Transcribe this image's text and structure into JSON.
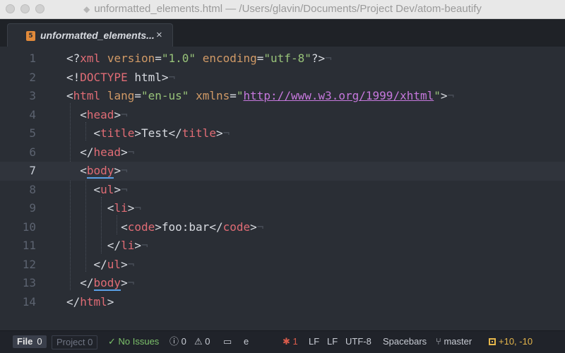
{
  "window": {
    "title": "unformatted_elements.html — /Users/glavin/Documents/Project Dev/atom-beautify"
  },
  "tab": {
    "title": "unformatted_elements...",
    "close": "×"
  },
  "editor": {
    "line_numbers": [
      "1",
      "2",
      "3",
      "4",
      "5",
      "6",
      "7",
      "8",
      "9",
      "10",
      "11",
      "12",
      "13",
      "14"
    ],
    "current_line": 7
  },
  "code": {
    "l1": {
      "open": "<?",
      "xml": "xml",
      "attr1": "version",
      "eq1": "=",
      "val1": "\"1.0\"",
      "attr2": "encoding",
      "eq2": "=",
      "val2": "\"utf-8\"",
      "close": "?>"
    },
    "l2": {
      "open": "<!",
      "doctype": "DOCTYPE",
      "rest": " html",
      "close": ">"
    },
    "l3": {
      "open": "<",
      "tag": "html",
      "attr1": "lang",
      "eq1": "=",
      "val1": "\"en-us\"",
      "attr2": "xmlns",
      "eq2": "=",
      "q1": "\"",
      "url": "http://www.w3.org/1999/xhtml",
      "q2": "\"",
      "close": ">"
    },
    "l4": {
      "open": "<",
      "tag": "head",
      "close": ">"
    },
    "l5": {
      "open": "<",
      "tag": "title",
      "close": ">",
      "text": "Test",
      "open2": "</",
      "tag2": "title",
      "close2": ">"
    },
    "l6": {
      "open": "</",
      "tag": "head",
      "close": ">"
    },
    "l7": {
      "open": "<",
      "tag": "body",
      "close": ">"
    },
    "l8": {
      "open": "<",
      "tag": "ul",
      "close": ">"
    },
    "l9": {
      "open": "<",
      "tag": "li",
      "close": ">"
    },
    "l10": {
      "open": "<",
      "tag": "code",
      "close": ">",
      "text": "foo:bar",
      "open2": "</",
      "tag2": "code",
      "close2": ">"
    },
    "l11": {
      "open": "</",
      "tag": "li",
      "close": ">"
    },
    "l12": {
      "open": "</",
      "tag": "ul",
      "close": ">"
    },
    "l13": {
      "open": "</",
      "tag": "body",
      "close": ">"
    },
    "l14": {
      "open": "</",
      "tag": "html",
      "close": ">"
    },
    "eol": "¬"
  },
  "statusbar": {
    "file_label": "File",
    "file_count": "0",
    "project_label": "Project",
    "project_count": "0",
    "linter_status": "✓ No Issues",
    "errors_icon": "ⓘ",
    "errors_count": "0",
    "warnings_icon": "⚠",
    "warnings_count": "0",
    "encoding_letter": "e",
    "bugs_count": "1",
    "line_ending_1": "LF",
    "line_ending_2": "LF",
    "encoding": "UTF-8",
    "indentation": "Spacebars",
    "branch": "master",
    "diff": "+10, -10"
  },
  "colors": {
    "background": "#2a2e35",
    "tag": "#e06c75",
    "attribute": "#d19a66",
    "string": "#98c379",
    "url": "#c678dd",
    "linter_ok": "#7cc26b"
  }
}
